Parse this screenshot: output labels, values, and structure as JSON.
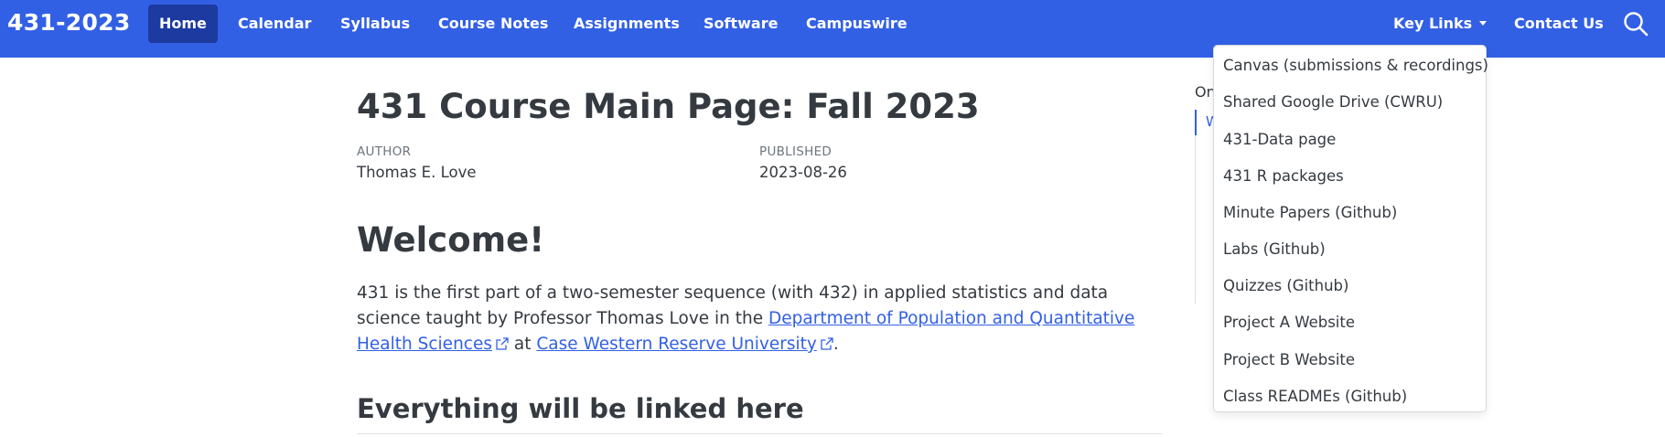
{
  "navbar": {
    "brand": "431-2023",
    "items": [
      {
        "label": "Home",
        "active": true
      },
      {
        "label": "Calendar"
      },
      {
        "label": "Syllabus"
      },
      {
        "label": "Course Notes"
      },
      {
        "label": "Assignments"
      },
      {
        "label": "Software"
      },
      {
        "label": "Campuswire"
      }
    ],
    "key_links": "Key Links",
    "contact": "Contact Us",
    "search_icon": "search-icon",
    "color": "#3260e5",
    "active_color": "#1c3aa0"
  },
  "page": {
    "title": "431 Course Main Page: Fall 2023",
    "author_label": "AUTHOR",
    "author": "Thomas E. Love",
    "published_label": "PUBLISHED",
    "published": "2023-08-26",
    "welcome_heading": "Welcome!",
    "intro": {
      "text1": "431 is the first part of a two-semester sequence (with 432) in applied statistics and data science taught by Professor Thomas Love in the ",
      "link1": "Department of Population and Quantitative Health Sciences",
      "text2": " at ",
      "link2": "Case Western Reserve University",
      "text3": "."
    },
    "linked_heading": "Everything will be linked here"
  },
  "toc": {
    "title_fragment": "On",
    "first_item_fragment": "W"
  },
  "dropdown": {
    "items": [
      "Canvas (submissions & recordings)",
      "Shared Google Drive (CWRU)",
      "431-Data page",
      "431 R packages",
      "Minute Papers (Github)",
      "Labs (Github)",
      "Quizzes (Github)",
      "Project A Website",
      "Project B Website",
      "Class READMEs (Github)"
    ]
  }
}
